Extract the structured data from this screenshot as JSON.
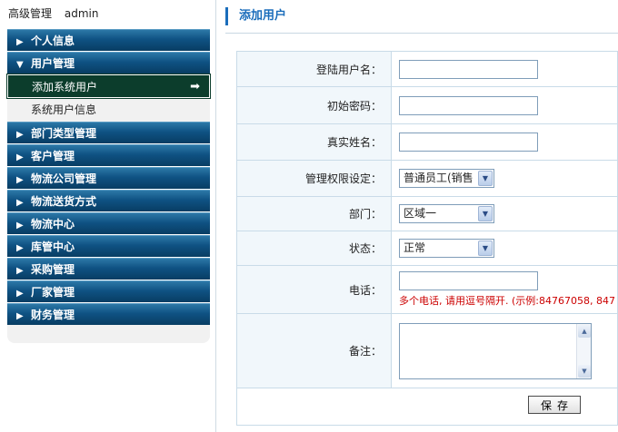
{
  "header": {
    "role": "高级管理",
    "username": "admin"
  },
  "sidebar": {
    "items": [
      {
        "label": "个人信息",
        "type": "head",
        "expanded": false
      },
      {
        "label": "用户管理",
        "type": "head",
        "expanded": true
      },
      {
        "label": "添加系统用户",
        "type": "sub",
        "active": true
      },
      {
        "label": "系统用户信息",
        "type": "sub",
        "active": false
      },
      {
        "label": "部门类型管理",
        "type": "head",
        "expanded": false
      },
      {
        "label": "客户管理",
        "type": "head",
        "expanded": false
      },
      {
        "label": "物流公司管理",
        "type": "head",
        "expanded": false
      },
      {
        "label": "物流送货方式",
        "type": "head",
        "expanded": false
      },
      {
        "label": "物流中心",
        "type": "head",
        "expanded": false
      },
      {
        "label": "库管中心",
        "type": "head",
        "expanded": false
      },
      {
        "label": "采购管理",
        "type": "head",
        "expanded": false
      },
      {
        "label": "厂家管理",
        "type": "head",
        "expanded": false
      },
      {
        "label": "财务管理",
        "type": "head",
        "expanded": false
      }
    ],
    "collapsed_glyph": "▶",
    "expanded_glyph": "▼",
    "active_arrow": "➡"
  },
  "main": {
    "title": "添加用户",
    "form": {
      "login_label": "登陆用户名：",
      "login_value": "",
      "password_label": "初始密码：",
      "password_value": "",
      "realname_label": "真实姓名：",
      "realname_value": "",
      "permission_label": "管理权限设定：",
      "permission_value": "普通员工(销售",
      "department_label": "部门：",
      "department_value": "区域一",
      "status_label": "状态：",
      "status_value": "正常",
      "phone_label": "电话：",
      "phone_value": "",
      "phone_hint": "多个电话, 请用逗号隔开. (示例:84767058, 847",
      "remark_label": "备注：",
      "remark_value": "",
      "save_label": "保存"
    }
  },
  "colors": {
    "accent": "#1a6dbb",
    "menu_dark": "#0f5283",
    "active_item": "#0c3d2c",
    "hint": "#cc0000"
  }
}
